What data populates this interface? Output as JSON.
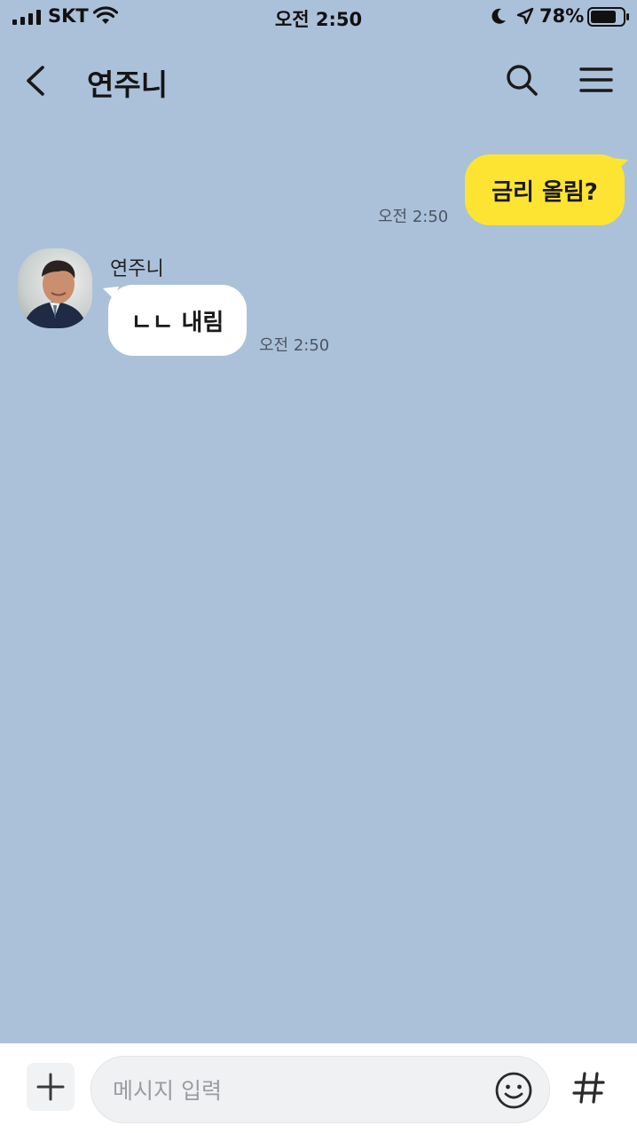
{
  "status_bar": {
    "carrier": "SKT",
    "time": "오전 2:50",
    "battery": "78%",
    "icons": [
      "signal-icon",
      "wifi-icon",
      "moon-icon",
      "location-icon",
      "battery-icon"
    ]
  },
  "header": {
    "title": "연주니",
    "icons": [
      "back-icon",
      "search-icon",
      "menu-icon"
    ]
  },
  "messages": [
    {
      "direction": "outgoing",
      "text": "금리 올림?",
      "time": "오전 2:50"
    },
    {
      "direction": "incoming",
      "sender": "연주니",
      "text": "ㄴㄴ 내림",
      "time": "오전 2:50"
    }
  ],
  "input_bar": {
    "placeholder": "메시지 입력",
    "icons": [
      "plus-icon",
      "emoji-icon",
      "hashtag-icon"
    ]
  },
  "colors": {
    "chat_background": "#abc1d9",
    "outgoing_bubble": "#fde432",
    "incoming_bubble": "#ffffff"
  }
}
